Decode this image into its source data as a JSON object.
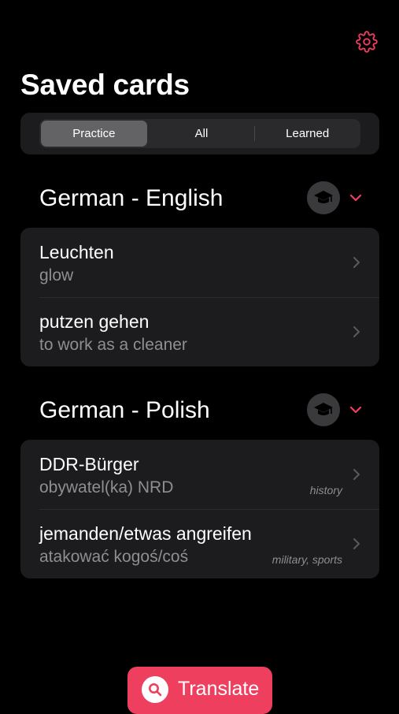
{
  "header": {
    "title": "Saved cards",
    "settings_icon": "gear-icon"
  },
  "tabs": [
    {
      "label": "Practice",
      "selected": true
    },
    {
      "label": "All",
      "selected": false
    },
    {
      "label": "Learned",
      "selected": false
    }
  ],
  "groups": [
    {
      "title": "German - English",
      "cards": [
        {
          "word": "Leuchten",
          "translation": "glow",
          "tag": ""
        },
        {
          "word": "putzen gehen",
          "translation": "to work as a cleaner",
          "tag": ""
        }
      ]
    },
    {
      "title": "German - Polish",
      "cards": [
        {
          "word": "DDR-Bürger",
          "translation": "obywatel(ka) NRD",
          "tag": "history"
        },
        {
          "word": "jemanden/etwas angreifen",
          "translation": "atakować kogoś/coś",
          "tag": "military, sports"
        }
      ]
    }
  ],
  "translate_button": {
    "label": "Translate",
    "icon": "search-icon"
  },
  "colors": {
    "accent": "#ef3f5e",
    "background": "#000000",
    "card_background": "#1c1c1e",
    "secondary_text": "#8e8e93"
  }
}
